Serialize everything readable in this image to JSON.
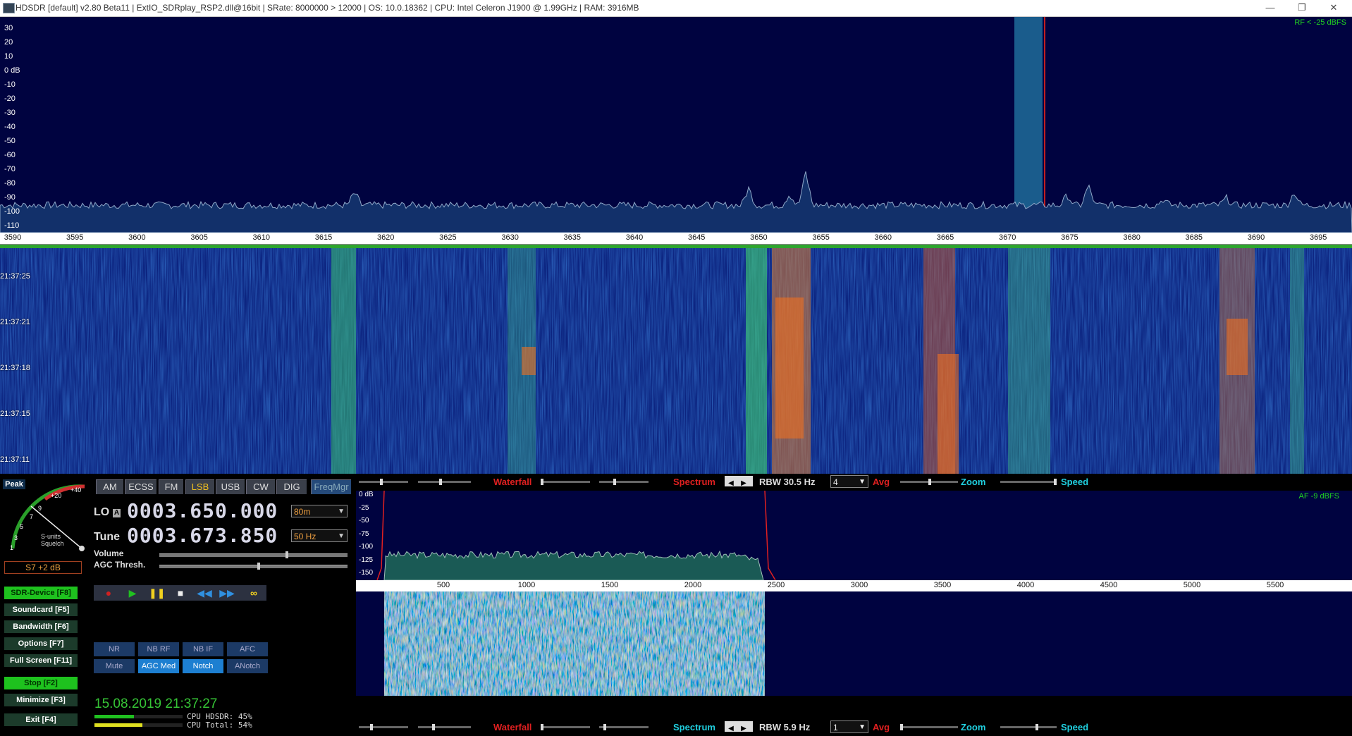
{
  "window": {
    "title": "HDSDR  [default]  v2.80 Beta11  |  ExtIO_SDRplay_RSP2.dll@16bit  |  SRate: 8000000 > 12000  |  OS: 10.0.18362   |  CPU: Intel Celeron  J1900  @ 1.99GHz  |  RAM: 3916MB",
    "minimize": "—",
    "restore": "❐",
    "close": "✕"
  },
  "spectrum": {
    "rf_label": "RF < -25 dBFS",
    "db_labels": [
      "30",
      "20",
      "10",
      "0 dB",
      "-10",
      "-20",
      "-30",
      "-40",
      "-50",
      "-60",
      "-70",
      "-80",
      "-90",
      "-100",
      "-110"
    ],
    "freq_labels": [
      "3590",
      "3595",
      "3600",
      "3605",
      "3610",
      "3615",
      "3620",
      "3625",
      "3630",
      "3635",
      "3640",
      "3645",
      "3650",
      "3655",
      "3660",
      "3665",
      "3670",
      "3675",
      "3680",
      "3685",
      "3690",
      "3695"
    ]
  },
  "waterfall": {
    "times": [
      "21:37:25",
      "21:37:21",
      "21:37:18",
      "21:37:15",
      "21:37:11"
    ]
  },
  "smeter": {
    "peak": "Peak",
    "scale": [
      "1",
      "3",
      "5",
      "7",
      "9",
      "+20",
      "+40"
    ],
    "caption1": "S-units",
    "caption2": "Squelch",
    "reading": "S7 +2 dB"
  },
  "modes": [
    "AM",
    "ECSS",
    "FM",
    "LSB",
    "USB",
    "CW",
    "DIG"
  ],
  "active_mode": "LSB",
  "freqmgr": "FreqMgr",
  "lo": {
    "label": "LO",
    "badge": "A",
    "value": "0003.650.000",
    "band": "80m"
  },
  "tune": {
    "label": "Tune",
    "value": "0003.673.850",
    "step": "50 Hz"
  },
  "volume_label": "Volume",
  "volume_level": 0.68,
  "agc_label": "AGC Thresh.",
  "agc_level": 0.53,
  "side_buttons": [
    {
      "label": "SDR-Device  [F8]"
    },
    {
      "label": "Soundcard  [F5]"
    },
    {
      "label": "Bandwidth  [F6]"
    },
    {
      "label": "Options  [F7]"
    },
    {
      "label": "Full Screen  [F11]"
    },
    {
      "label": "Stop  [F2]"
    },
    {
      "label": "Minimize  [F3]"
    },
    {
      "label": "Exit  [F4]"
    }
  ],
  "dsp_row1": [
    "NR",
    "NB RF",
    "NB IF",
    "AFC"
  ],
  "dsp_row2": [
    "Mute",
    "AGC Med",
    "Notch",
    "ANotch"
  ],
  "clock": "15.08.2019 21:37:27",
  "cpu_hdsdr": "CPU HDSDR:  45%",
  "cpu_total": "CPU Total:  54%",
  "cpu_hdsdr_pct": 45,
  "cpu_total_pct": 54,
  "rf_bar": {
    "waterfall": "Waterfall",
    "spectrum": "Spectrum",
    "rbw": "RBW  30.5 Hz",
    "avg_value": "4",
    "avg": "Avg",
    "zoom": "Zoom",
    "speed": "Speed"
  },
  "af_spectrum": {
    "af_label": "AF  -9 dBFS",
    "db_labels": [
      "0 dB",
      "-25",
      "-50",
      "-75",
      "-100",
      "-125",
      "-150"
    ],
    "freq_labels": [
      "500",
      "1000",
      "1500",
      "2000",
      "2500",
      "3000",
      "3500",
      "4000",
      "4500",
      "5000",
      "5500"
    ]
  },
  "af_bar": {
    "waterfall": "Waterfall",
    "spectrum": "Spectrum",
    "rbw": "RBW   5.9 Hz",
    "avg_value": "1",
    "avg": "Avg",
    "zoom": "Zoom",
    "speed": "Speed"
  },
  "colors": {
    "accent_red": "#e02020",
    "accent_cyan": "#20d0e0",
    "accent_green": "#2ea52e",
    "spectrum_bg": "#000340"
  }
}
